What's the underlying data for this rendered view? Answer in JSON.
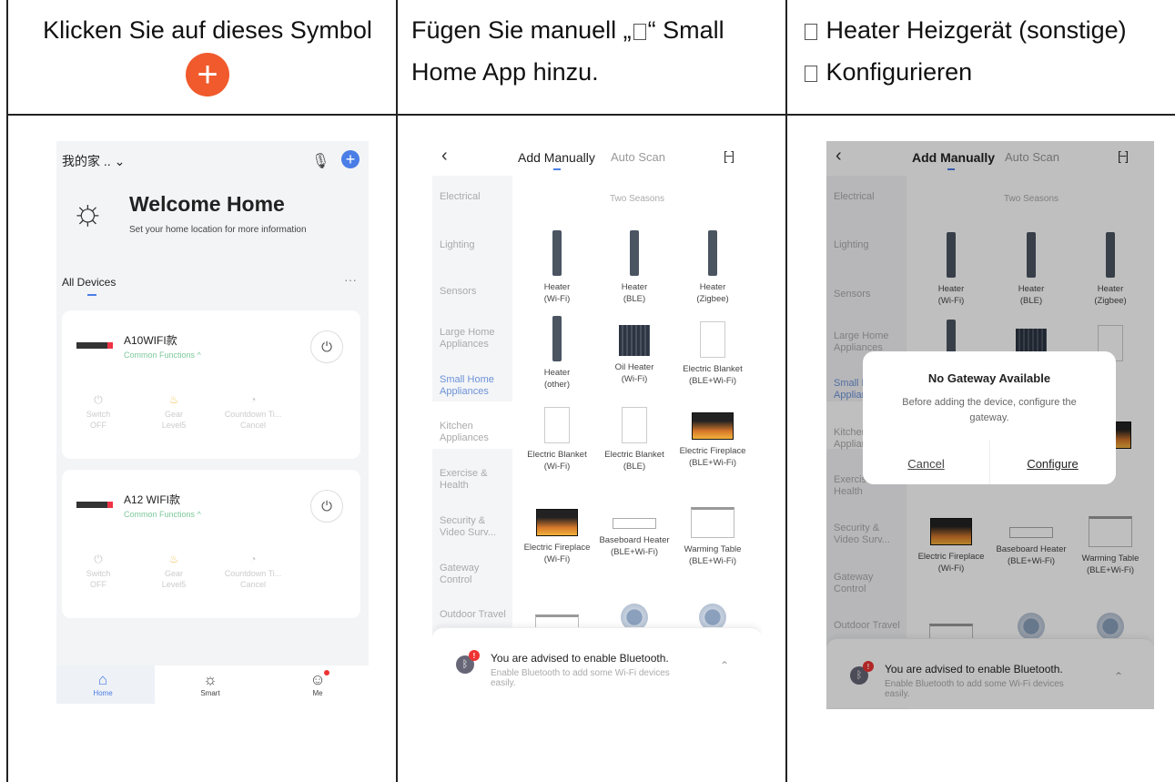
{
  "header": {
    "col1_text": "Klicken Sie auf dieses Symbol",
    "col1_icon": "plus-circle-icon",
    "col2_line1_before": "Fügen Sie manuell „",
    "col2_line1_after": "“ Small",
    "col2_line2": "Home App hinzu.",
    "col3_line1": "Heater Heizgerät (sonstige)",
    "col3_line2": "Konfigurieren"
  },
  "phone1": {
    "home_name": "我的家 ..",
    "welcome": "Welcome Home",
    "subtitle": "Set your home location for more information",
    "all_devices": "All Devices",
    "devices": [
      {
        "name": "A10WIFI款",
        "func": "Common Functions ^",
        "ctrl1": "Switch",
        "ctrl1_sub": "OFF",
        "ctrl2": "Gear",
        "ctrl2_sub": "Level5",
        "ctrl3": "Countdown Ti...",
        "ctrl3_sub": "Cancel"
      },
      {
        "name": "A12 WIFI款",
        "func": "Common Functions ^",
        "ctrl1": "Switch",
        "ctrl1_sub": "OFF",
        "ctrl2": "Gear",
        "ctrl2_sub": "Level5",
        "ctrl3": "Countdown Ti...",
        "ctrl3_sub": "Cancel"
      }
    ],
    "nav": [
      "Home",
      "Smart",
      "Me"
    ]
  },
  "add": {
    "tab_manual": "Add Manually",
    "tab_scan": "Auto Scan",
    "group": "Two Seasons",
    "sidebar": [
      "Electrical",
      "Lighting",
      "Sensors",
      "Large Home Appliances",
      "Small Home Appliances",
      "Kitchen Appliances",
      "Exercise & Health",
      "Security & Video Surv...",
      "Gateway Control",
      "Outdoor Travel"
    ],
    "items": [
      {
        "l1": "Heater",
        "l2": "(Wi-Fi)"
      },
      {
        "l1": "Heater",
        "l2": "(BLE)"
      },
      {
        "l1": "Heater",
        "l2": "(Zigbee)"
      },
      {
        "l1": "Heater",
        "l2": "(other)"
      },
      {
        "l1": "Oil Heater",
        "l2": "(Wi-Fi)"
      },
      {
        "l1": "Electric Blanket",
        "l2": "(BLE+Wi-Fi)"
      },
      {
        "l1": "Electric Blanket",
        "l2": "(Wi-Fi)"
      },
      {
        "l1": "Electric Blanket",
        "l2": "(BLE)"
      },
      {
        "l1": "Electric Fireplace",
        "l2": "(BLE+Wi-Fi)"
      },
      {
        "l1": "Electric Fireplace",
        "l2": "(Wi-Fi)"
      },
      {
        "l1": "Baseboard Heater",
        "l2": "(BLE+Wi-Fi)"
      },
      {
        "l1": "Warming Table",
        "l2": "(BLE+Wi-Fi)"
      }
    ],
    "bt_title": "You are advised to enable Bluetooth.",
    "bt_sub": "Enable Bluetooth to add some Wi-Fi devices easily."
  },
  "dialog": {
    "title": "No Gateway Available",
    "message": "Before adding the device, configure the gateway.",
    "cancel": "Cancel",
    "configure": "Configure"
  }
}
